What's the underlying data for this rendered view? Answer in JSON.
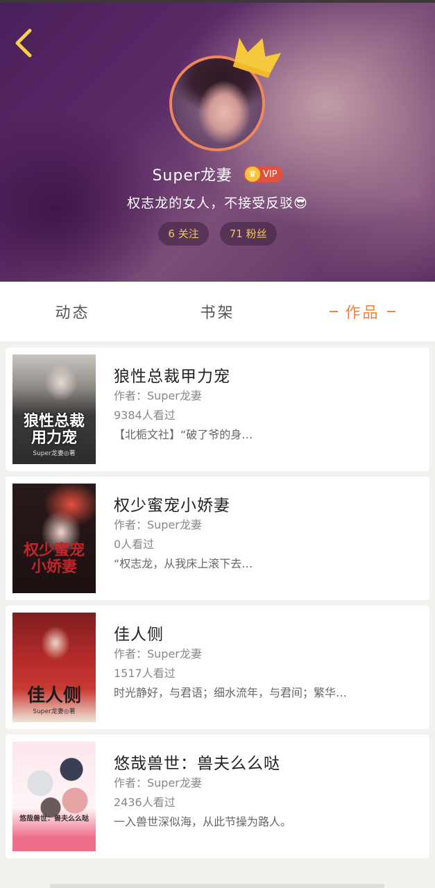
{
  "profile": {
    "username": "Super龙妻",
    "vip_label": "VIP",
    "bio": "权志龙的女人，不接受反驳😎",
    "following": "6 关注",
    "followers": "71 粉丝"
  },
  "tabs": [
    {
      "label": "动态"
    },
    {
      "label": "书架"
    },
    {
      "label": "作品"
    }
  ],
  "works": [
    {
      "title": "狼性总裁甲力宠",
      "author": "作者：Super龙妻",
      "views": "9384人看过",
      "desc": "【北栀文社】“破了爷的身…",
      "cover_text": "狼性总裁\n用力宠",
      "cover_sub": "Super龙妻◎著"
    },
    {
      "title": "权少蜜宠小娇妻",
      "author": "作者：Super龙妻",
      "views": "0人看过",
      "desc": "“权志龙，从我床上滚下去…",
      "cover_text": "权少蜜宠\n小娇妻",
      "cover_sub": ""
    },
    {
      "title": "佳人侧",
      "author": "作者：Super龙妻",
      "views": "1517人看过",
      "desc": "时光静好，与君语；细水流年，与君间；繁华…",
      "cover_text": "佳人侧",
      "cover_sub": "Super龙妻◎著"
    },
    {
      "title": "悠哉兽世：兽夫么么哒",
      "author": "作者：Super龙妻",
      "views": "2436人看过",
      "desc": "一入兽世深似海，从此节操为路人。",
      "cover_text": "悠哉兽世：兽夫么么哒",
      "cover_sub": ""
    }
  ],
  "colors": {
    "accent": "#f0843f",
    "stat_text": "#f4c94d",
    "vip_badge": "#e0523f"
  },
  "icons": {
    "back": "chevron-left-icon",
    "crown": "crown-icon"
  }
}
